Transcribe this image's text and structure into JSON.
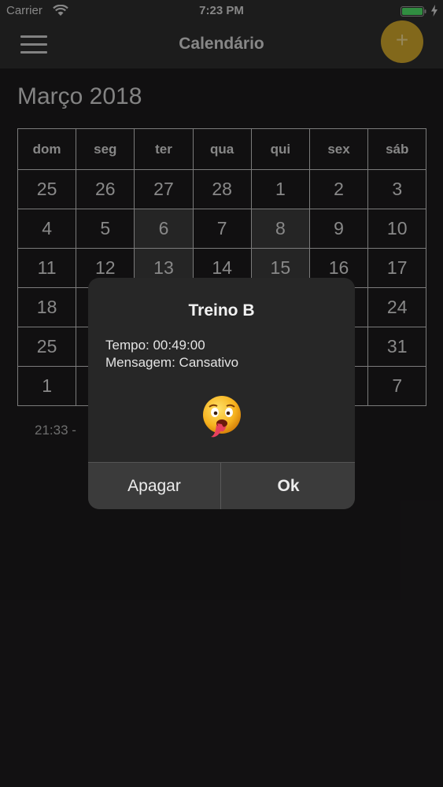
{
  "status_bar": {
    "carrier": "Carrier",
    "time": "7:23 PM",
    "battery_color": "#4cd964"
  },
  "nav": {
    "title": "Calendário",
    "add_icon": "+",
    "accent_color": "#c8a02a"
  },
  "calendar": {
    "month_title": "Março 2018",
    "weekdays": [
      "dom",
      "seg",
      "ter",
      "qua",
      "qui",
      "sex",
      "sáb"
    ],
    "weeks": [
      [
        "25",
        "26",
        "27",
        "28",
        "1",
        "2",
        "3"
      ],
      [
        "4",
        "5",
        "6",
        "7",
        "8",
        "9",
        "10"
      ],
      [
        "11",
        "12",
        "13",
        "14",
        "15",
        "16",
        "17"
      ],
      [
        "18",
        "",
        "",
        "",
        "",
        "",
        "24"
      ],
      [
        "25",
        "",
        "",
        "",
        "",
        "",
        "31"
      ],
      [
        "1",
        "",
        "",
        "",
        "",
        "",
        "7"
      ]
    ],
    "footer": "21:33 -"
  },
  "alert": {
    "title": "Treino B",
    "tempo": "Tempo: 00:49:00",
    "mensagem": "Mensagem: Cansativo",
    "emoji": "exhausted-face-icon",
    "buttons": {
      "delete": "Apagar",
      "ok": "Ok"
    }
  }
}
